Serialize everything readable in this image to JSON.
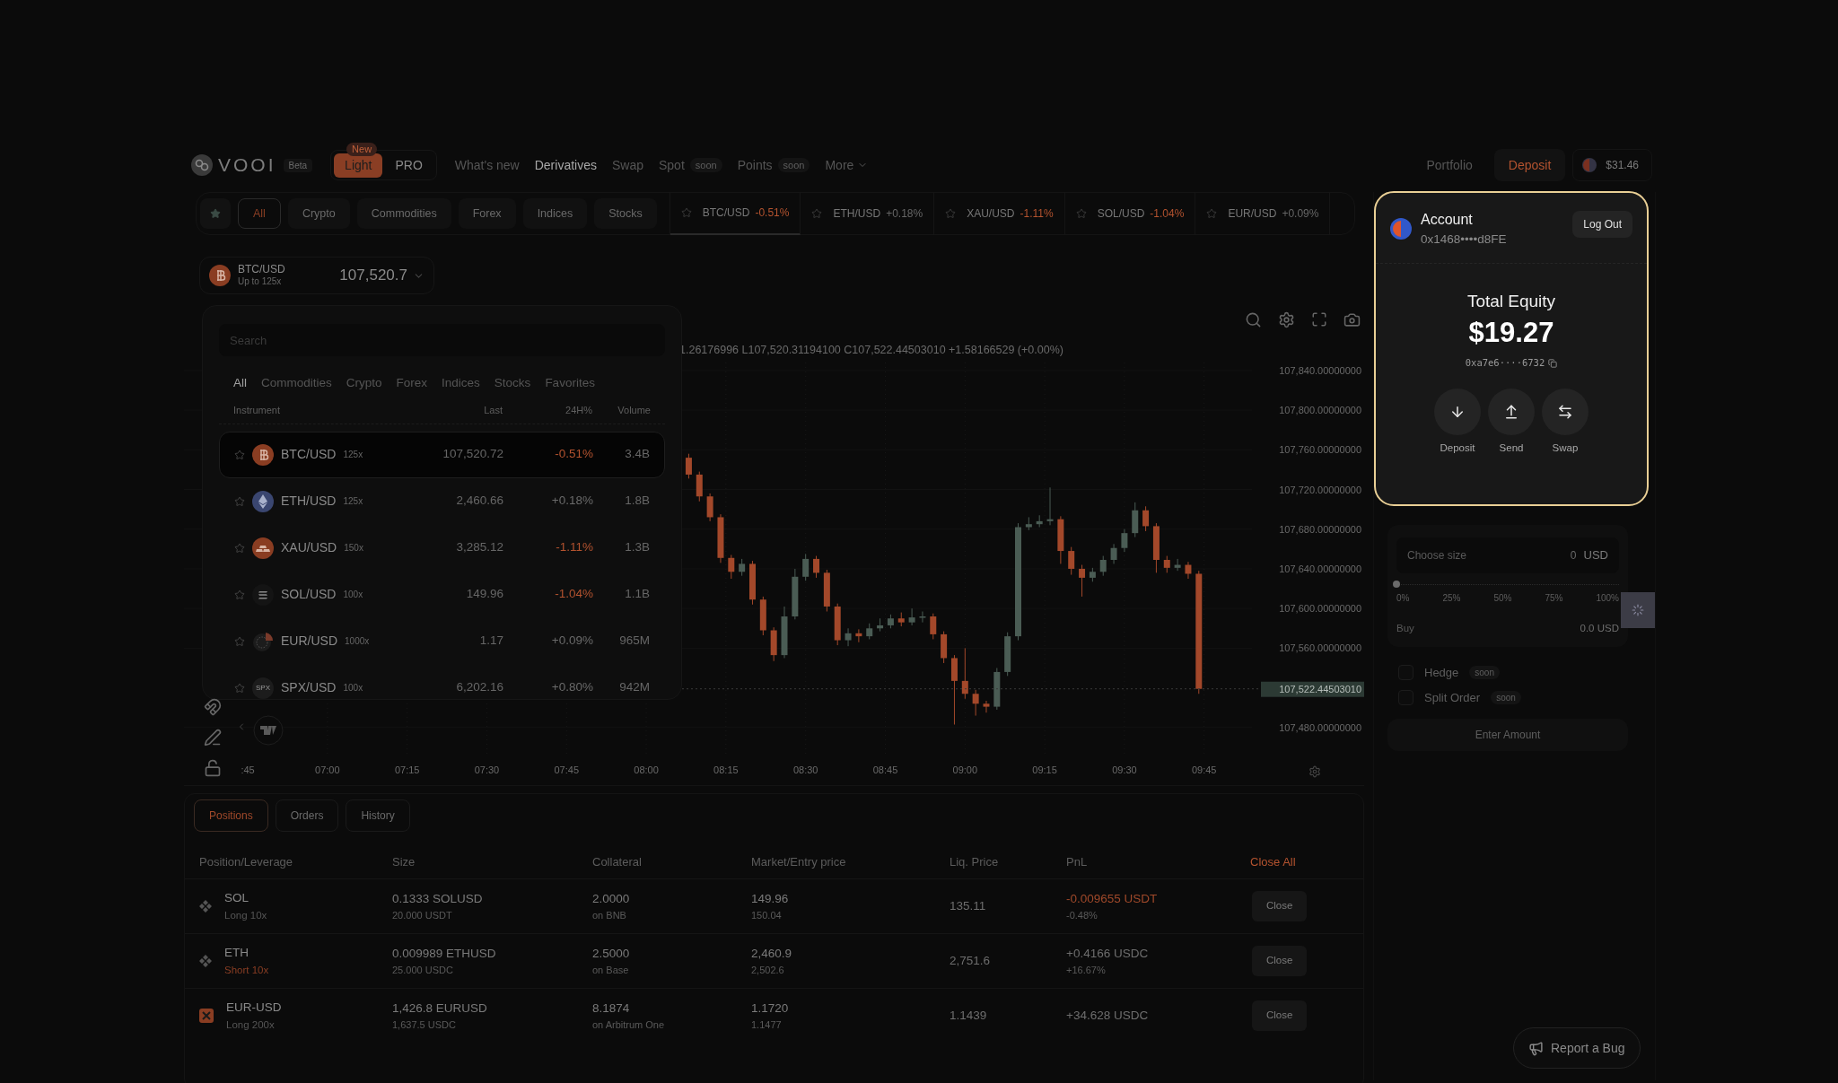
{
  "brand": {
    "name": "VOOI",
    "badge": "Beta"
  },
  "mode_toggle": [
    {
      "label": "Light",
      "selected": true,
      "badge": "New"
    },
    {
      "label": "PRO",
      "selected": false
    }
  ],
  "nav": [
    {
      "label": "What's new",
      "selected": false
    },
    {
      "label": "Derivatives",
      "selected": true
    },
    {
      "label": "Swap",
      "selected": false
    },
    {
      "label": "Spot",
      "badge": "soon",
      "selected": false
    },
    {
      "label": "Points",
      "badge": "soon",
      "selected": false
    }
  ],
  "more_menu": "More",
  "header_right": {
    "portfolio": "Portfolio",
    "deposit": "Deposit",
    "balance": "$31.46"
  },
  "category_filters": [
    {
      "label": "All",
      "selected": true
    },
    {
      "label": "Crypto",
      "selected": false
    },
    {
      "label": "Commodities",
      "selected": false
    },
    {
      "label": "Forex",
      "selected": false
    },
    {
      "label": "Indices",
      "selected": false
    },
    {
      "label": "Stocks",
      "selected": false
    }
  ],
  "tickers": [
    {
      "symbol": "BTC/USD",
      "change": "-0.51%",
      "negative": true,
      "selected": true
    },
    {
      "symbol": "ETH/USD",
      "change": "+0.18%",
      "negative": false,
      "selected": false
    },
    {
      "symbol": "XAU/USD",
      "change": "-1.11%",
      "negative": true,
      "selected": false
    },
    {
      "symbol": "SOL/USD",
      "change": "-1.04%",
      "negative": true,
      "selected": false
    },
    {
      "symbol": "EUR/USD",
      "change": "+0.09%",
      "negative": false,
      "selected": false
    }
  ],
  "market": {
    "symbol": "BTC/USD",
    "leverage": "Up to 125x",
    "price": "107,520.7"
  },
  "instrument_menu": {
    "placeholder": "Search",
    "tabs": [
      {
        "label": "All",
        "selected": true
      },
      {
        "label": "Commodities",
        "selected": false
      },
      {
        "label": "Crypto",
        "selected": false
      },
      {
        "label": "Forex",
        "selected": false
      },
      {
        "label": "Indices",
        "selected": false
      },
      {
        "label": "Stocks",
        "selected": false
      },
      {
        "label": "Favorites",
        "selected": false
      }
    ],
    "columns": [
      "Instrument",
      "Last",
      "24H%",
      "Volume"
    ],
    "rows": [
      {
        "kind": "btc",
        "symbol": "BTC/USD",
        "leverage": "125x",
        "last": "107,520.72",
        "change": "-0.51%",
        "negative": true,
        "volume": "3.4B",
        "selected": true
      },
      {
        "kind": "eth",
        "symbol": "ETH/USD",
        "leverage": "125x",
        "last": "2,460.66",
        "change": "+0.18%",
        "negative": false,
        "volume": "1.8B",
        "selected": false
      },
      {
        "kind": "xau",
        "symbol": "XAU/USD",
        "leverage": "150x",
        "last": "3,285.12",
        "change": "-1.11%",
        "negative": true,
        "volume": "1.3B",
        "selected": false
      },
      {
        "kind": "sol",
        "symbol": "SOL/USD",
        "leverage": "100x",
        "last": "149.96",
        "change": "-1.04%",
        "negative": true,
        "volume": "1.1B",
        "selected": false
      },
      {
        "kind": "eur",
        "symbol": "EUR/USD",
        "leverage": "1000x",
        "last": "1.17",
        "change": "+0.09%",
        "negative": false,
        "volume": "965M",
        "selected": false
      },
      {
        "kind": "spx",
        "icon_text": "SPX",
        "symbol": "SPX/USD",
        "leverage": "100x",
        "last": "6,202.16",
        "change": "+0.80%",
        "negative": false,
        "volume": "942M",
        "selected": false
      }
    ]
  },
  "chart": {
    "ohlc": "1.26176996 L107,520.31194100 C107,522.44503010 +1.58166529 (+0.00%)",
    "current_price": "107,522.44503010",
    "time_axis_cut": ":45",
    "chart_data": {
      "type": "candlestick",
      "ylim": [
        107450,
        107848
      ],
      "xlim": [
        393,
        594
      ],
      "grid": true,
      "x": [
        488,
        490,
        492,
        494,
        496,
        498,
        500,
        502,
        504,
        506,
        508,
        510,
        512,
        514,
        516,
        518,
        520,
        522,
        524,
        526,
        528,
        530,
        532,
        534,
        536,
        538,
        540,
        542,
        544,
        546,
        548,
        550,
        552,
        554,
        556,
        558,
        560,
        562,
        564,
        566,
        568,
        570,
        572,
        574,
        576,
        578,
        580,
        582,
        584
      ],
      "xticks": [
        {
          "value": 420,
          "label": "07:00"
        },
        {
          "value": 435,
          "label": "07:15"
        },
        {
          "value": 450,
          "label": "07:30"
        },
        {
          "value": 465,
          "label": "07:45"
        },
        {
          "value": 480,
          "label": "08:00"
        },
        {
          "value": 495,
          "label": "08:15"
        },
        {
          "value": 510,
          "label": "08:30"
        },
        {
          "value": 525,
          "label": "08:45"
        },
        {
          "value": 540,
          "label": "09:00"
        },
        {
          "value": 555,
          "label": "09:15"
        },
        {
          "value": 570,
          "label": "09:30"
        },
        {
          "value": 585,
          "label": "09:45"
        }
      ],
      "ohlc": [
        [
          107752,
          107756,
          107731,
          107735
        ],
        [
          107735,
          107738,
          107708,
          107713
        ],
        [
          107713,
          107716,
          107688,
          107692
        ],
        [
          107692,
          107695,
          107646,
          107651
        ],
        [
          107651,
          107654,
          107630,
          107637
        ],
        [
          107637,
          107650,
          107633,
          107645
        ],
        [
          107645,
          107648,
          107604,
          107609
        ],
        [
          107609,
          107612,
          107573,
          107578
        ],
        [
          107578,
          107581,
          107547,
          107553
        ],
        [
          107553,
          107602,
          107550,
          107592
        ],
        [
          107592,
          107640,
          107589,
          107632
        ],
        [
          107632,
          107655,
          107628,
          107650
        ],
        [
          107650,
          107653,
          107631,
          107636
        ],
        [
          107636,
          107639,
          107597,
          107602
        ],
        [
          107602,
          107605,
          107563,
          107568
        ],
        [
          107568,
          107580,
          107562,
          107575
        ],
        [
          107575,
          107579,
          107566,
          107572
        ],
        [
          107572,
          107585,
          107569,
          107580
        ],
        [
          107580,
          107590,
          107577,
          107583
        ],
        [
          107583,
          107594,
          107580,
          107590
        ],
        [
          107590,
          107596,
          107582,
          107586
        ],
        [
          107586,
          107600,
          107583,
          107591
        ],
        [
          107591,
          107597,
          107586,
          107592
        ],
        [
          107592,
          107595,
          107569,
          107574
        ],
        [
          107574,
          107577,
          107545,
          107550
        ],
        [
          107550,
          107553,
          107483,
          107527
        ],
        [
          107527,
          107560,
          107509,
          107514
        ],
        [
          107514,
          107518,
          107492,
          107504
        ],
        [
          107504,
          107507,
          107495,
          107501
        ],
        [
          107501,
          107540,
          107498,
          107536
        ],
        [
          107536,
          107576,
          107532,
          107572
        ],
        [
          107572,
          107686,
          107568,
          107682
        ],
        [
          107682,
          107692,
          107679,
          107685
        ],
        [
          107685,
          107694,
          107682,
          107688
        ],
        [
          107688,
          107722,
          107684,
          107690
        ],
        [
          107690,
          107693,
          107645,
          107658
        ],
        [
          107658,
          107662,
          107634,
          107640
        ],
        [
          107640,
          107644,
          107612,
          107631
        ],
        [
          107631,
          107641,
          107627,
          107637
        ],
        [
          107637,
          107653,
          107633,
          107649
        ],
        [
          107649,
          107665,
          107645,
          107661
        ],
        [
          107661,
          107680,
          107657,
          107676
        ],
        [
          107676,
          107707,
          107672,
          107699
        ],
        [
          107699,
          107703,
          107678,
          107683
        ],
        [
          107683,
          107686,
          107636,
          107649
        ],
        [
          107649,
          107653,
          107636,
          107641
        ],
        [
          107641,
          107650,
          107638,
          107644
        ],
        [
          107644,
          107647,
          107630,
          107635
        ],
        [
          107635,
          107638,
          107514,
          107519
        ]
      ],
      "yticks": [
        {
          "value": 107840,
          "label": "107,840.00000000"
        },
        {
          "value": 107800,
          "label": "107,800.00000000"
        },
        {
          "value": 107760,
          "label": "107,760.00000000"
        },
        {
          "value": 107720,
          "label": "107,720.00000000"
        },
        {
          "value": 107680,
          "label": "107,680.00000000"
        },
        {
          "value": 107640,
          "label": "107,640.00000000"
        },
        {
          "value": 107600,
          "label": "107,600.00000000"
        },
        {
          "value": 107560,
          "label": "107,560.00000000"
        },
        {
          "value": 107480,
          "label": "107,480.00000000"
        }
      ]
    }
  },
  "positions": {
    "tabs": [
      {
        "label": "Positions",
        "selected": true
      },
      {
        "label": "Orders",
        "selected": false
      },
      {
        "label": "History",
        "selected": false
      }
    ],
    "columns": [
      "Position/Leverage",
      "Size",
      "Collateral",
      "Market/Entry price",
      "Liq. Price",
      "PnL"
    ],
    "close_all": "Close All",
    "rows": [
      {
        "kind": "diamond",
        "symbol": "SOL",
        "side": "Long 10x",
        "short": false,
        "size": "0.1333 SOLUSD",
        "size_sub": "20.000 USDT",
        "collateral": "2.0000",
        "network": "on BNB",
        "price": "149.96",
        "entry": "150.04",
        "liq": "135.11",
        "pnl": "-0.009655 USDT",
        "pnl_pct": "-0.48%",
        "negative": true,
        "action": "Close"
      },
      {
        "kind": "diamond",
        "symbol": "ETH",
        "side": "Short 10x",
        "short": true,
        "size": "0.009989 ETHUSD",
        "size_sub": "25.000 USDC",
        "collateral": "2.5000",
        "network": "on Base",
        "price": "2,460.9",
        "entry": "2,502.6",
        "liq": "2,751.6",
        "pnl": "+0.4166 USDC",
        "pnl_pct": "+16.67%",
        "negative": false,
        "action": "Close"
      },
      {
        "kind": "square",
        "symbol": "EUR-USD",
        "side": "Long 200x",
        "short": false,
        "size": "1,426.8 EURUSD",
        "size_sub": "1,637.5 USDC",
        "collateral": "8.1874",
        "network": "on Arbitrum One",
        "price": "1.1720",
        "entry": "1.1477",
        "liq": "1.1439",
        "pnl": "+34.628 USDC",
        "negative": false,
        "action": "Close"
      }
    ]
  },
  "account": {
    "title": "Account",
    "address": "0x1468••••d8FE",
    "logout": "Log Out",
    "equity_label": "Total Equity",
    "equity": "$19.27",
    "wallet": "0xa7e6····6732",
    "actions": [
      {
        "kind": "deposit",
        "label": "Deposit"
      },
      {
        "kind": "send",
        "label": "Send"
      },
      {
        "kind": "swap",
        "label": "Swap"
      }
    ]
  },
  "order": {
    "label": "Choose size",
    "amount": "0",
    "currency": "USD",
    "level": 0,
    "marks": [
      "0%",
      "25%",
      "50%",
      "75%",
      "100%"
    ],
    "buy_label": "Buy",
    "buy_value": "0.0 USD",
    "options": [
      {
        "label": "Hedge",
        "badge": "soon",
        "checked": false
      },
      {
        "label": "Split Order",
        "badge": "soon",
        "checked": false
      }
    ],
    "submit": "Enter Amount"
  },
  "report_bug": "Report a Bug"
}
